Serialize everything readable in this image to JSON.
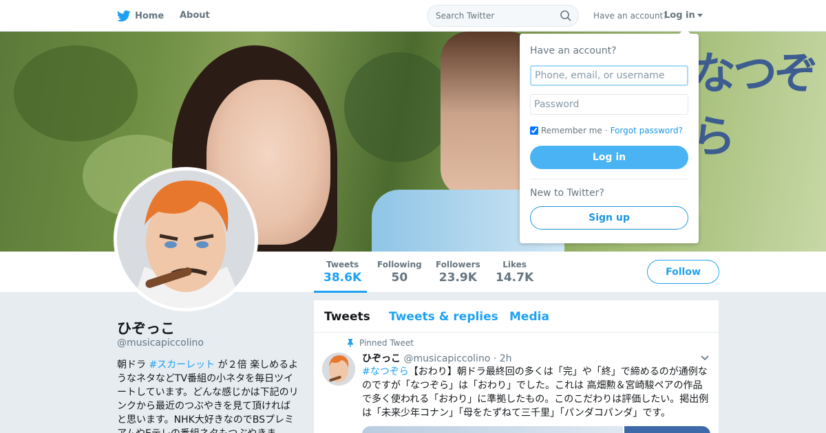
{
  "nav": {
    "home_label": "Home",
    "about_label": "About",
    "search_placeholder": "Search Twitter",
    "have_account": "Have an account?",
    "login_label": "Log in"
  },
  "profile": {
    "name": "ひぞっこ",
    "handle": "@musicapiccolino",
    "bio_prefix": "朝ドラ ",
    "bio_hashtag": "#スカーレット",
    "bio_rest": " が２倍 楽しめるようなネタなどTV番組の小ネタを毎日ツイートしています。どんな感じかは下記のリンクから最近のつぶやきを見て頂ければと思います。NHK大好きなのでBSプレミアムやEテレの番組ネタもつぶやきま",
    "follow_label": "Follow"
  },
  "stats": [
    {
      "label": "Tweets",
      "value": "38.6K"
    },
    {
      "label": "Following",
      "value": "50"
    },
    {
      "label": "Followers",
      "value": "23.9K"
    },
    {
      "label": "Likes",
      "value": "14.7K"
    }
  ],
  "timeline": {
    "tabs": [
      "Tweets",
      "Tweets & replies",
      "Media"
    ],
    "pinned_label": "Pinned Tweet",
    "tweet": {
      "author": "ひぞっこ",
      "handle": "@musicapiccolino",
      "time": "· 2h",
      "hashtag": "#なつぞら",
      "text": "【おわり】朝ドラ最終回の多くは「完」や「終」で締めるのが通例なのですが「なつぞら」は「おわり」でした。これは 高畑勲＆宮崎駿ペアの作品で多く使われる「おわり」に準拠したもの。このこだわりは評価したい。掲出例は「未来少年コナン」「母をたずねて三千里」「パンダコパンダ」です。"
    }
  },
  "banner": {
    "logo_text": "なつぞら"
  },
  "login_dropdown": {
    "title": "Have an account?",
    "username_placeholder": "Phone, email, or username",
    "password_placeholder": "Password",
    "remember_label": "Remember me",
    "separator": "·",
    "forgot_label": "Forgot password?",
    "login_button": "Log in",
    "new_label": "New to Twitter?",
    "signup_button": "Sign up"
  },
  "colors": {
    "accent": "#1da1f2",
    "login_button": "#4ab3f4",
    "background": "#e6ecf0"
  }
}
